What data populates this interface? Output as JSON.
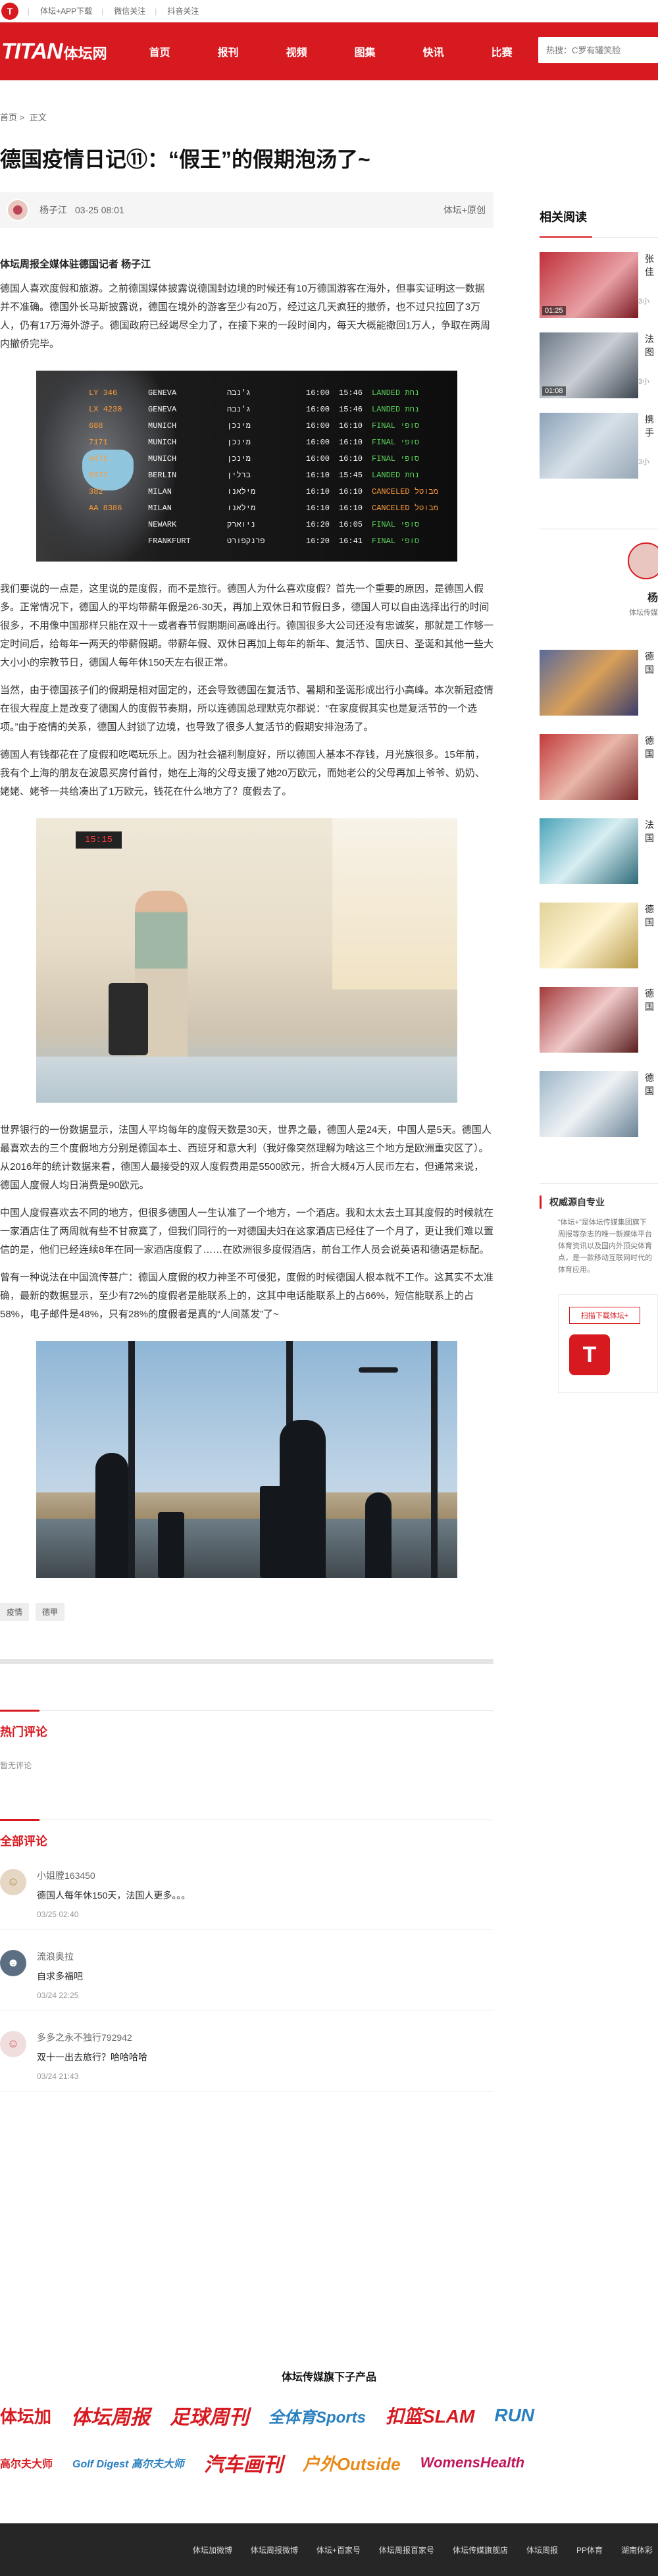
{
  "topbar": {
    "links": [
      "体坛+APP下载",
      "微信关注",
      "抖音关注"
    ]
  },
  "nav": {
    "brand_en": "TITAN",
    "brand_cn": "体坛网",
    "menu": [
      "首页",
      "报刊",
      "视频",
      "图集",
      "快讯",
      "比赛"
    ],
    "search_placeholder": "热搜：C罗有罐笑脸"
  },
  "breadcrumb": {
    "home": "首页",
    "sep": ">",
    "current": "正文"
  },
  "article": {
    "title": "德国疫情日记⑪：“假王”的假期泡汤了~",
    "author": "杨子江",
    "time": "03-25 08:01",
    "source": "体坛+原创",
    "byline": "体坛周报全媒体驻德国记者 杨子江",
    "paragraphs": [
      "德国人喜欢度假和旅游。之前德国媒体披露说德国封边境的时候还有10万德国游客在海外，但事实证明这一数据并不准确。德国外长马斯披露说，德国在境外的游客至少有20万，经过这几天疯狂的撤侨，也不过只拉回了3万人，仍有17万海外游子。德国政府已经竭尽全力了，在接下来的一段时间内，每天大概能撤回1万人，争取在两周内撤侨完毕。",
      "我们要说的一点是，这里说的是度假，而不是旅行。德国人为什么喜欢度假？首先一个重要的原因，是德国人假多。正常情况下，德国人的平均带薪年假是26-30天，再加上双休日和节假日多，德国人可以自由选择出行的时间很多，不用像中国那样只能在双十一或者春节假期期间高峰出行。德国很多大公司还没有忠诚奖，那就是工作够一定时间后，给每年一两天的带薪假期。带薪年假、双休日再加上每年的新年、复活节、国庆日、圣诞和其他一些大大小小的宗教节日，德国人每年休150天左右很正常。",
      "当然，由于德国孩子们的假期是相对固定的，还会导致德国在复活节、暑期和圣诞形成出行小高峰。本次新冠疫情在很大程度上是改变了德国人的度假节奏期，所以连德国总理默克尔都说：“在家度假其实也是复活节的一个选项。”由于疫情的关系，德国人封锁了边境，也导致了很多人复活节的假期安排泡汤了。",
      "德国人有钱都花在了度假和吃喝玩乐上。因为社会福利制度好，所以德国人基本不存钱，月光族很多。15年前，我有个上海的朋友在波恩买房付首付，她在上海的父母支援了她20万欧元，而她老公的父母再加上爷爷、奶奶、姥姥、姥爷一共给凑出了1万欧元，钱花在什么地方了？度假去了。",
      "世界银行的一份数据显示，法国人平均每年的度假天数是30天，世界之最，德国人是24天，中国人是5天。德国人最喜欢去的三个度假地方分别是德国本土、西班牙和意大利（我好像突然理解为啥这三个地方是欧洲重灾区了）。从2016年的统计数据来看，德国人最接受的双人度假费用是5500欧元，折合大概4万人民币左右，但通常来说，德国人度假人均日消费是90欧元。",
      "中国人度假喜欢去不同的地方，但很多德国人一生认准了一个地方，一个酒店。我和太太去土耳其度假的时候就在一家酒店住了两周就有些不甘寂寞了，但我们同行的一对德国夫妇在这家酒店已经住了一个月了，更让我们难以置信的是，他们已经连续8年在同一家酒店度假了……在欧洲很多度假酒店，前台工作人员会说英语和德语是标配。",
      "曾有一种说法在中国流传甚广：德国人度假的权力神圣不可侵犯，度假的时候德国人根本就不工作。这其实不太准确，最新的数据显示，至少有72%的度假者是能联系上的，这其中电话能联系上的占66%，短信能联系上的占58%，电子邮件是48%，只有28%的度假者是真的“人间蒸发”了~"
    ],
    "board_rows": [
      [
        "LY 346",
        "GENEVA",
        "ג'נבה",
        "16:00",
        "15:46",
        "LANDED נחת"
      ],
      [
        "LX 4230",
        "GENEVA",
        "ג'נבה",
        "16:00",
        "15:46",
        "LANDED נחת"
      ],
      [
        "688",
        "MUNICH",
        "מינכן",
        "16:00",
        "16:10",
        "FINAL סופי"
      ],
      [
        "7171",
        "MUNICH",
        "מינכן",
        "16:00",
        "16:10",
        "FINAL סופי"
      ],
      [
        "9471",
        "MUNICH",
        "מינכן",
        "16:00",
        "16:10",
        "FINAL סופי"
      ],
      [
        "8372",
        "BERLIN",
        "ברלין",
        "16:10",
        "15:45",
        "LANDED נחת"
      ],
      [
        "382",
        "MILAN",
        "מילאנו",
        "16:10",
        "16:10",
        "CANCELED מבוטל"
      ],
      [
        "AA 8386",
        "MILAN",
        "מילאנו",
        "16:10",
        "16:10",
        "CANCELED מבוטל"
      ],
      [
        "",
        "NEWARK",
        "ניוארק",
        "16:20",
        "16:05",
        "FINAL סופי"
      ],
      [
        "",
        "FRANKFURT",
        "פרנקפורט",
        "16:20",
        "16:41",
        "FINAL סופי"
      ]
    ],
    "travel_board": "15:15",
    "tags": [
      "疫情",
      "德甲"
    ]
  },
  "comments": {
    "hot_title": "热门评论",
    "hot_empty": "暂无评论",
    "all_title": "全部评论",
    "items": [
      {
        "name": "小姐膛163450",
        "text": "德国人每年休150天，法国人更多。。。",
        "time": "03/25 02:40"
      },
      {
        "name": "流浪奥拉",
        "text": "自求多福吧",
        "time": "03/24 22:25"
      },
      {
        "name": "多多之永不独行792942",
        "text": "双十一出去旅行？哈哈哈哈",
        "time": "03/24 21:43"
      }
    ]
  },
  "sidebar": {
    "related_title": "相关阅读",
    "related": [
      {
        "title": "张佳",
        "sub": "",
        "duration": "01:25",
        "meta": "3小"
      },
      {
        "title": "法图",
        "sub": "",
        "duration": "01:08",
        "meta": "3小"
      },
      {
        "title": "携手",
        "sub": "",
        "duration": "",
        "meta": "3小"
      }
    ],
    "profile": {
      "name": "杨",
      "desc": "体坛传媒"
    },
    "cards": [
      "德国",
      "德国",
      "法国",
      "德国",
      "德国",
      "德国"
    ],
    "auth": {
      "title": "权威源自专业",
      "desc": "“体坛+”是体坛传媒集团旗下\n周报等杂志的唯一新媒体平台\n体育资讯以及国内外顶尖体育\n点，是一款移动互联网时代的\n体育应用。",
      "button": "扫描下载体坛+",
      "logo": "T"
    }
  },
  "products": {
    "title": "体坛传媒旗下子产品",
    "row1": [
      "体坛加",
      "体坛周报",
      "足球周刊",
      "全体育Sports",
      "扣篮SLAM",
      "RUN"
    ],
    "row2": [
      "高尔夫大师",
      "Golf Digest 高尔夫大师",
      "汽车画刊",
      "户外Outside",
      "WomensHealth"
    ]
  },
  "footer": {
    "links": [
      "体坛加微博",
      "体坛周报微博",
      "体坛+百家号",
      "体坛周报百家号",
      "体坛传媒旗舰店",
      "体坛周报",
      "PP体育",
      "湖南体彩"
    ]
  },
  "colors": {
    "brand_red": "#d71920"
  }
}
